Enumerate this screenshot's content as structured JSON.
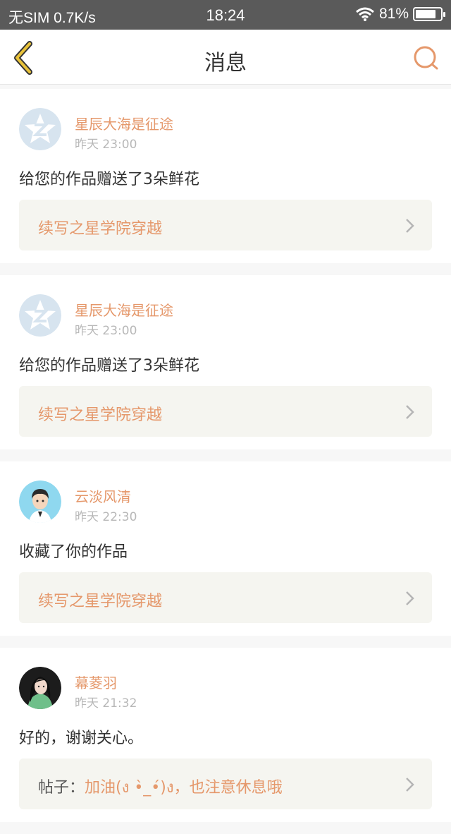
{
  "status_bar": {
    "carrier": "无SIM 0.7K/s",
    "time": "18:24",
    "battery": "81%",
    "battery_level": 0.81
  },
  "nav": {
    "title": "消息",
    "back_icon": "chevron-left-icon",
    "search_icon": "search-icon"
  },
  "colors": {
    "accent": "#e5986b",
    "back_icon": "#e8c23a"
  },
  "messages": [
    {
      "name": "星辰大海是征途",
      "time": "昨天 23:00",
      "text": "给您的作品赠送了3朵鲜花",
      "link_prefix": "",
      "link": "续写之星学院穿越",
      "avatar": "default-avatar"
    },
    {
      "name": "星辰大海是征途",
      "time": "昨天 23:00",
      "text": "给您的作品赠送了3朵鲜花",
      "link_prefix": "",
      "link": "续写之星学院穿越",
      "avatar": "default-avatar"
    },
    {
      "name": "云淡风清",
      "time": "昨天 22:30",
      "text": "收藏了你的作品",
      "link_prefix": "",
      "link": "续写之星学院穿越",
      "avatar": "cartoon-boy-avatar"
    },
    {
      "name": "幕菱羽",
      "time": "昨天 21:32",
      "text": "好的，谢谢关心。",
      "link_prefix": "帖子：",
      "link": "加油(ง •̀_•́)ง，也注意休息哦",
      "avatar": "girl-photo-avatar"
    }
  ]
}
